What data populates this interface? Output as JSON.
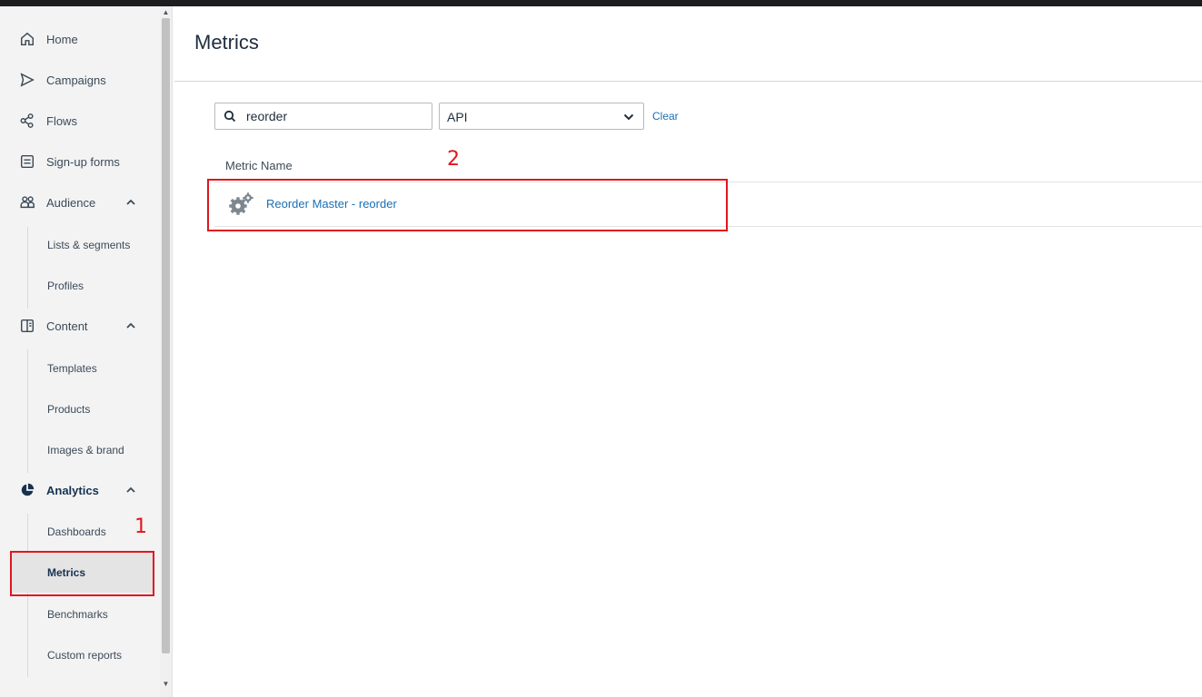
{
  "nav": {
    "home": "Home",
    "campaigns": "Campaigns",
    "flows": "Flows",
    "signup_forms": "Sign-up forms",
    "audience": "Audience",
    "audience_items": [
      "Lists & segments",
      "Profiles"
    ],
    "content": "Content",
    "content_items": [
      "Templates",
      "Products",
      "Images & brand"
    ],
    "analytics": "Analytics",
    "analytics_items": [
      "Dashboards",
      "Metrics",
      "Benchmarks",
      "Custom reports"
    ]
  },
  "main": {
    "title": "Metrics",
    "search_value": "reorder",
    "filter_value": "API",
    "clear_label": "Clear",
    "column_header": "Metric Name",
    "rows": [
      {
        "name": "Reorder Master - reorder",
        "icon": "gears-icon"
      }
    ]
  },
  "annotations": {
    "step1": "1",
    "step2": "2",
    "color": "#e0161f"
  },
  "colors": {
    "link": "#1a6fb5",
    "sidebar_bg": "#f3f3f3",
    "selected_bg": "#e4e4e4"
  }
}
